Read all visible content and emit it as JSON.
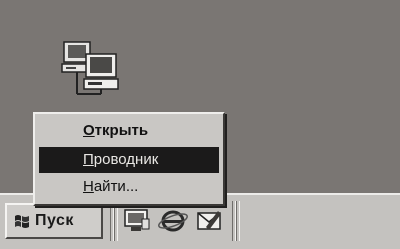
{
  "desktop": {
    "icon": "network-neighborhood-icon"
  },
  "context_menu": {
    "items": [
      {
        "label_first": "О",
        "label_rest": "ткрыть",
        "bold": true,
        "selected": false
      },
      {
        "label_first": "П",
        "label_rest": "роводник",
        "bold": false,
        "selected": true
      },
      {
        "label_first": "Н",
        "label_rest": "айти...",
        "bold": false,
        "selected": false
      }
    ]
  },
  "taskbar": {
    "start_label": "Пуск",
    "start_icon": "windows-flag-icon",
    "quick_launch": [
      "desktop-icon",
      "internet-explorer-icon",
      "outlook-express-icon"
    ]
  }
}
